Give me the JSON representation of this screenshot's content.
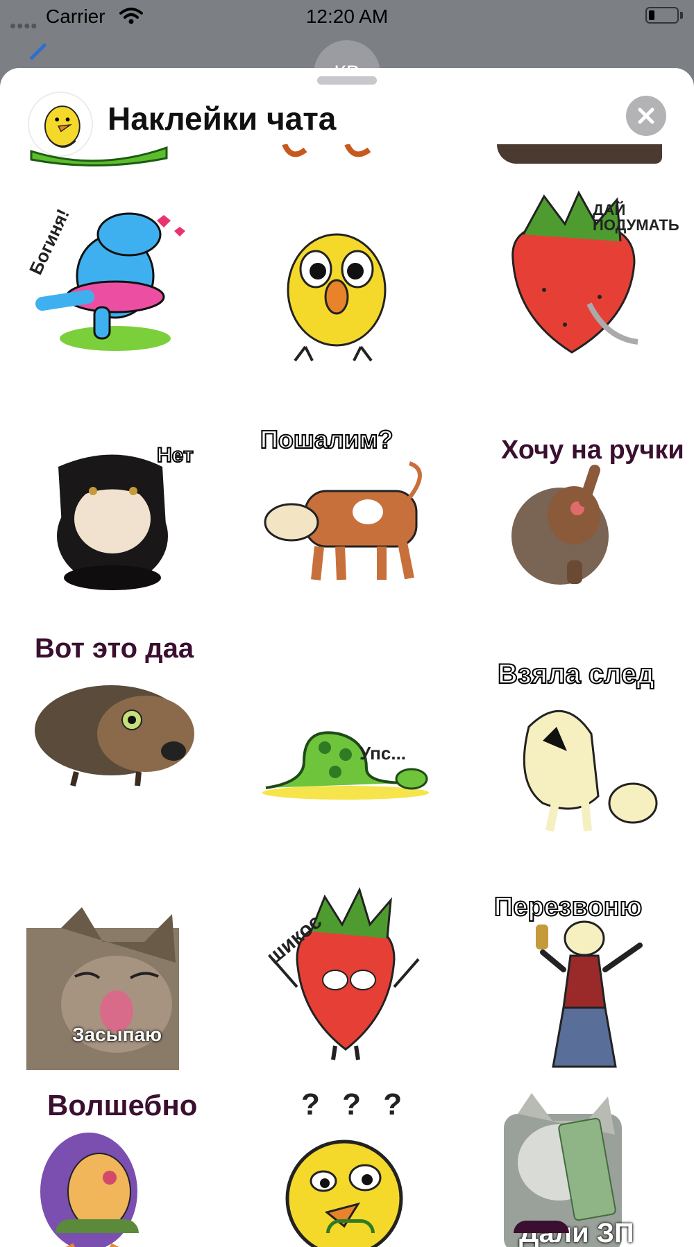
{
  "status_bar": {
    "carrier": "Carrier",
    "time": "12:20 AM",
    "battery_level": 0.2
  },
  "background": {
    "avatar_initials": "КВ"
  },
  "header": {
    "title": "Наклейки чата"
  },
  "stickers": [
    {
      "id": "goddess-hippo",
      "caption": "Богиня!"
    },
    {
      "id": "amazed-chick",
      "caption": ""
    },
    {
      "id": "thinking-strawberry",
      "caption": "ДАЙ ПОДУМАТЬ"
    },
    {
      "id": "no-cat",
      "caption": "Нет"
    },
    {
      "id": "naughty-cow",
      "caption": "Пошалим?"
    },
    {
      "id": "hedgehog-hold-me",
      "caption": "Хочу на ручки"
    },
    {
      "id": "wow-hedgehog",
      "caption": "Вот это даа"
    },
    {
      "id": "oops-snake",
      "caption": "Упс..."
    },
    {
      "id": "tracking-cow",
      "caption": "Взяла след"
    },
    {
      "id": "sleepy-cat",
      "caption": "Засыпаю"
    },
    {
      "id": "chic-strawberry",
      "caption": "шикос"
    },
    {
      "id": "call-back-cow",
      "caption": "Перезвоню"
    },
    {
      "id": "magic-hedgehog",
      "caption": "Волшебно"
    },
    {
      "id": "confused-chick",
      "caption": "? ? ?"
    },
    {
      "id": "payday-cat",
      "caption": "Дали ЗП"
    }
  ],
  "colors": {
    "sheet": "#ffffff",
    "backdrop": "#7c7f84",
    "close_button": "#b3b3b6",
    "caption": "#3b0f2f"
  }
}
